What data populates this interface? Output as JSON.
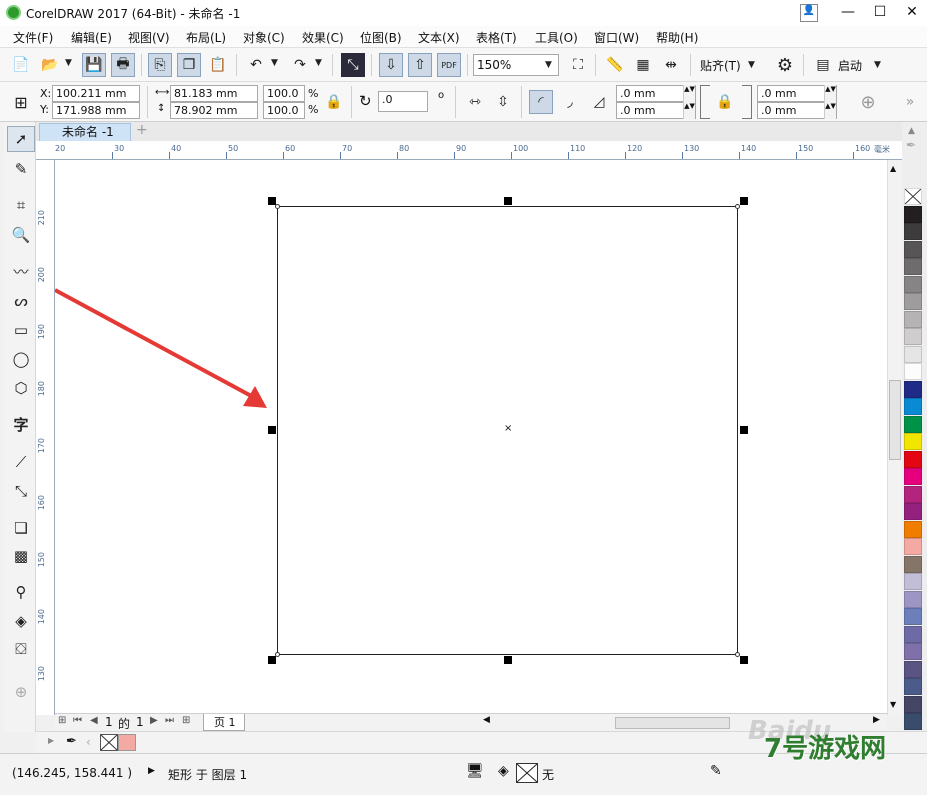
{
  "window": {
    "title": "CorelDRAW 2017 (64-Bit) - 未命名 -1",
    "minimize": "—",
    "maximize": "☐",
    "close": "✕"
  },
  "menu": [
    "文件(F)",
    "编辑(E)",
    "视图(V)",
    "布局(L)",
    "对象(C)",
    "效果(C)",
    "位图(B)",
    "文本(X)",
    "表格(T)",
    "工具(O)",
    "窗口(W)",
    "帮助(H)"
  ],
  "standard_toolbar": {
    "zoom": "150%",
    "align_label": "贴齐(T)",
    "launch_label": "启动",
    "pdf_label": "PDF"
  },
  "property_bar": {
    "x_label": "X:",
    "x_value": "100.211 mm",
    "y_label": "Y:",
    "y_value": "171.988 mm",
    "width_value": "81.183 mm",
    "height_value": "78.902 mm",
    "scale_x": "100.0",
    "scale_y": "100.0",
    "percent": "%",
    "rotation": ".0",
    "degree": "o",
    "corner_1": ".0 mm",
    "corner_2": ".0 mm",
    "corner_3": ".0 mm",
    "corner_4": ".0 mm"
  },
  "document_tab": {
    "name": "未命名 -1",
    "add": "+"
  },
  "ruler": {
    "h_ticks": [
      "30",
      "40",
      "50",
      "60",
      "70",
      "80",
      "90",
      "100",
      "110",
      "120",
      "130",
      "140",
      "150",
      "160"
    ],
    "h_start": "20",
    "h_unit": "毫米",
    "v_ticks": [
      "210",
      "200",
      "190",
      "180",
      "170",
      "160",
      "150",
      "140",
      "130"
    ]
  },
  "page_nav": {
    "current": "1",
    "of": "的",
    "total": "1",
    "page_tab": "页 1"
  },
  "color_bar": {
    "none_label": "无"
  },
  "status": {
    "cursor_coords": "(146.245, 158.441 )",
    "selection_info": "矩形 于 图层 1",
    "fill_none": "无"
  },
  "palette_colors": [
    "#ffffff",
    "#231f20",
    "#3d3b3c",
    "#575556",
    "#6e6c6d",
    "#868485",
    "#9e9c9d",
    "#b5b3b4",
    "#cfcdce",
    "#e6e5e5",
    "#fcfcfc",
    "#1f2b87",
    "#0a8ad3",
    "#009246",
    "#f2e500",
    "#e30613",
    "#e6007e",
    "#b3247f",
    "#95217e",
    "#f07d00",
    "#f4a9a3",
    "#847568",
    "#c3bed7",
    "#9d96c4",
    "#6d7fba",
    "#6e6aa5",
    "#8070aa",
    "#5a5482",
    "#4b5c8a",
    "#454566",
    "#3a4c6b",
    "#8fc7ea"
  ],
  "tools": [
    "pick-tool",
    "shape-tool",
    "crop-tool",
    "zoom-tool",
    "freehand-tool",
    "artistic-media-tool",
    "rectangle-tool",
    "ellipse-tool",
    "polygon-tool",
    "text-tool",
    "parallel-dimension-tool",
    "connector-tool",
    "drop-shadow-tool",
    "transparency-tool",
    "color-eyedropper-tool",
    "interactive-fill-tool",
    "smart-fill-tool",
    "add-tool"
  ],
  "text_tool_glyph": "字",
  "overlay_text": "7号游戏网",
  "watermark_text": "Baidu"
}
